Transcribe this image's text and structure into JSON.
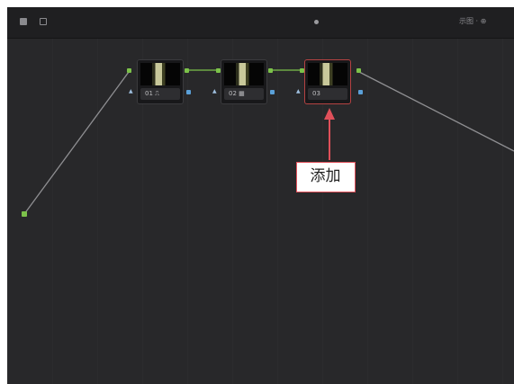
{
  "colors": {
    "panel_bg": "#262628",
    "toolbar_bg": "#1f1f21",
    "node_border_selected": "#b44242",
    "port_green": "#7cc24a",
    "port_blue": "#5aa0d8",
    "callout_border": "#e0505a"
  },
  "toolbar": {
    "left_icons": [
      "select-icon",
      "grid-icon"
    ],
    "center_icon": "dot-menu-icon",
    "right_text": "示图 · ⊕"
  },
  "nodes": [
    {
      "id": "01",
      "label": "01 ⎍",
      "selected": false
    },
    {
      "id": "02",
      "label": "02 ▦",
      "selected": false
    },
    {
      "id": "03",
      "label": "03",
      "selected": true
    }
  ],
  "annotation": {
    "text": "添加",
    "arrow_icon": "up-arrow-icon"
  }
}
